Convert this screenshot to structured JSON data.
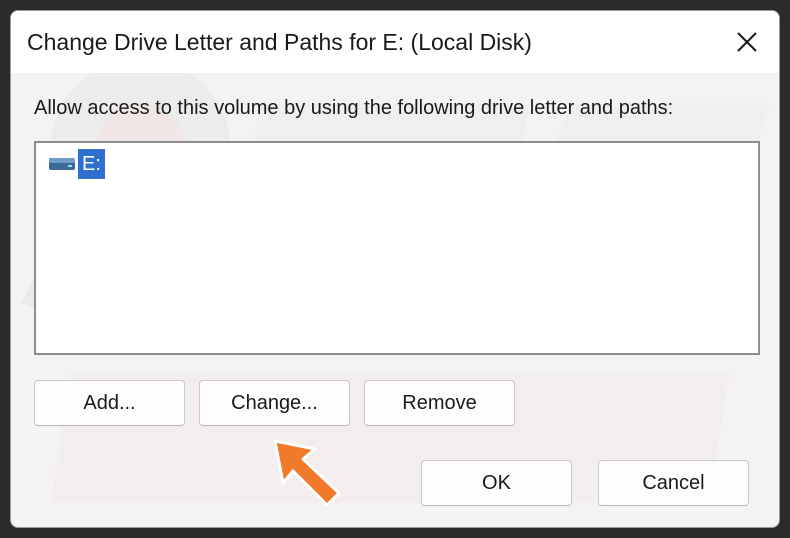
{
  "dialog": {
    "title": "Change Drive Letter and Paths for E: (Local Disk)",
    "close_icon": "close-icon"
  },
  "instruction": "Allow access to this volume by using the following drive letter and paths:",
  "paths_list": {
    "items": [
      {
        "label": "E:",
        "icon": "drive-icon",
        "selected": true
      }
    ]
  },
  "buttons": {
    "add": "Add...",
    "change": "Change...",
    "remove": "Remove",
    "ok": "OK",
    "cancel": "Cancel"
  },
  "annotation": {
    "icon": "arrow-pointer-icon",
    "color": "#f07a2a"
  },
  "colors": {
    "selection": "#2f6fcf",
    "dialog_bg": "#f3f3f3",
    "titlebar_bg": "#ffffff"
  }
}
